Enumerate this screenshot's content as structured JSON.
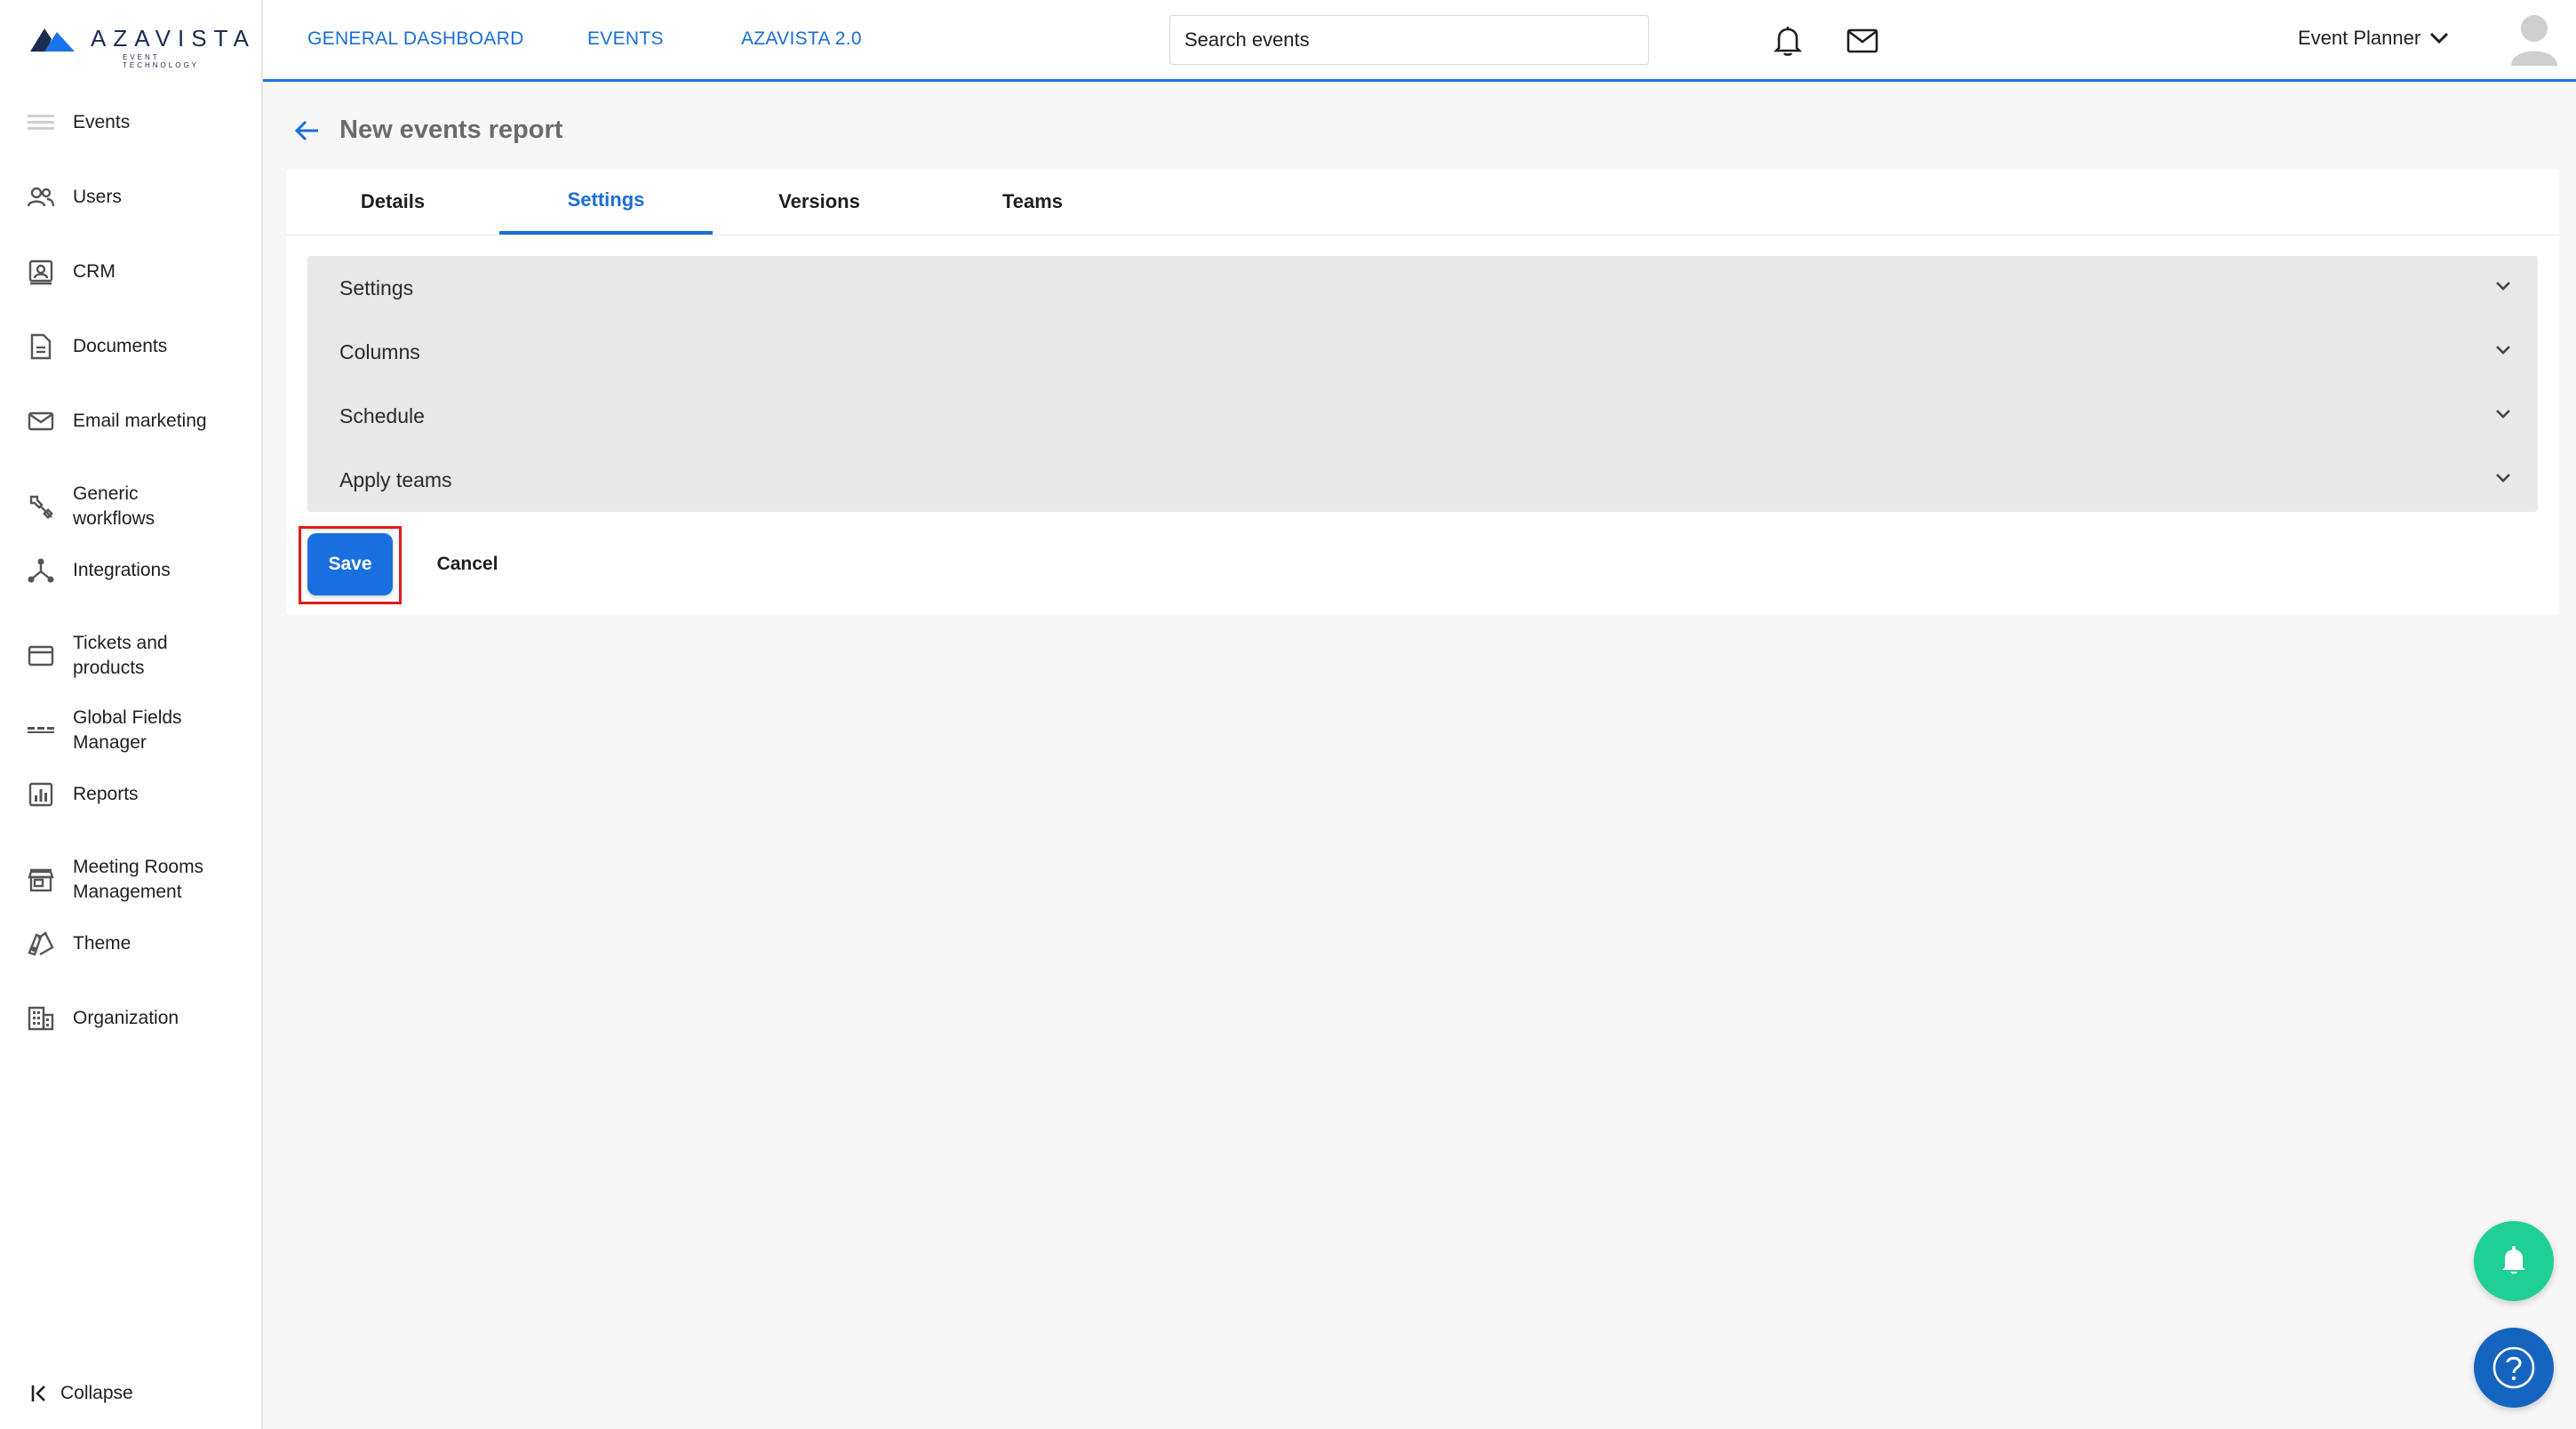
{
  "brand": {
    "name": "AZAVISTA",
    "tagline": "EVENT TECHNOLOGY",
    "color": "#1d2b4f"
  },
  "colors": {
    "accent": "#1a6ed6",
    "highlight": "#e01b1b",
    "notify_fab": "#1fcf95",
    "help_fab": "#1565c0"
  },
  "sidebar": {
    "items": [
      {
        "label": "Events",
        "icon": "events-icon"
      },
      {
        "label": "Users",
        "icon": "users-icon"
      },
      {
        "label": "CRM",
        "icon": "crm-icon"
      },
      {
        "label": "Documents",
        "icon": "document-icon"
      },
      {
        "label": "Email marketing",
        "icon": "mail-icon"
      },
      {
        "label": "Generic workflows",
        "icon": "wrench-icon"
      },
      {
        "label": "Integrations",
        "icon": "integrations-icon"
      },
      {
        "label": "Tickets and products",
        "icon": "card-icon"
      },
      {
        "label": "Global Fields Manager",
        "icon": "fields-icon"
      },
      {
        "label": "Reports",
        "icon": "reports-icon"
      },
      {
        "label": "Meeting Rooms Management",
        "icon": "store-icon"
      },
      {
        "label": "Theme",
        "icon": "theme-icon"
      },
      {
        "label": "Organization",
        "icon": "building-icon"
      }
    ],
    "collapse_label": "Collapse"
  },
  "topbar": {
    "links": [
      "GENERAL DASHBOARD",
      "EVENTS",
      "AZAVISTA 2.0"
    ],
    "search_placeholder": "Search events",
    "user_menu_label": "Event Planner"
  },
  "page": {
    "title": "New events report",
    "tabs": [
      {
        "label": "Details",
        "active": false
      },
      {
        "label": "Settings",
        "active": true
      },
      {
        "label": "Versions",
        "active": false
      },
      {
        "label": "Teams",
        "active": false
      }
    ],
    "sections": [
      "Settings",
      "Columns",
      "Schedule",
      "Apply teams"
    ],
    "save_label": "Save",
    "cancel_label": "Cancel"
  }
}
